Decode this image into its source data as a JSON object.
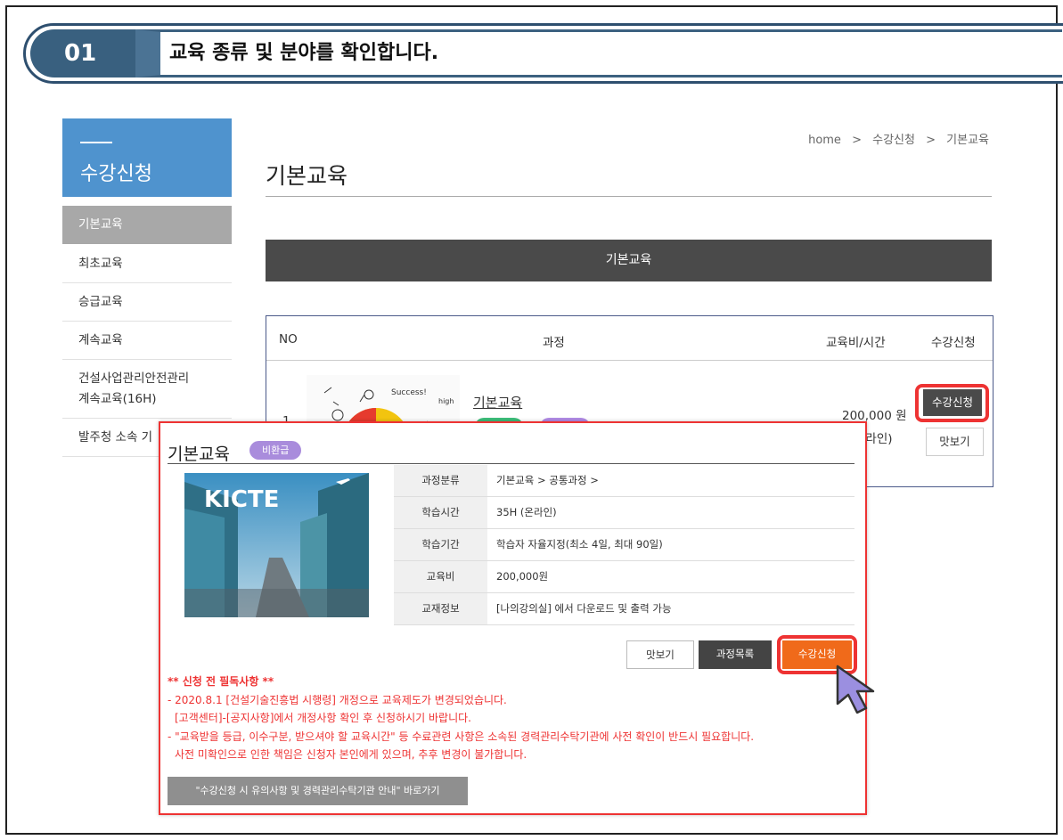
{
  "banner": {
    "step_number": "01",
    "title": "교육 종류 및 분야를 확인합니다."
  },
  "sidebar": {
    "heading": "수강신청",
    "items": [
      {
        "label": "기본교육",
        "active": true
      },
      {
        "label": "최초교육"
      },
      {
        "label": "승급교육"
      },
      {
        "label": "계속교육"
      },
      {
        "label": "건설사업관리안전관리"
      },
      {
        "label": "계속교육(16H)"
      },
      {
        "label": "발주청 소속 기"
      }
    ]
  },
  "breadcrumb": {
    "home": "home",
    "sep": ">",
    "level1": "수강신청",
    "level2": "기본교육"
  },
  "page": {
    "title": "기본교육",
    "section_bar": "기본교육"
  },
  "table": {
    "headers": {
      "no": "NO",
      "course": "과정",
      "fee_time": "교육비/시간",
      "apply": "수강신청"
    },
    "row": {
      "no": "1",
      "course_link": "기본교육",
      "price": "200,000 원",
      "mode": "온라인)",
      "apply_button": "수강신청",
      "preview_button": "맛보기"
    }
  },
  "popup": {
    "title": "기본교육",
    "badge": "비환급",
    "image_text": "KICTE",
    "info": [
      {
        "key": "과정분류",
        "value": "기본교육 > 공통과정 >"
      },
      {
        "key": "학습시간",
        "value": "35H (온라인)"
      },
      {
        "key": "학습기간",
        "value": "학습자 자율지정(최소 4일, 최대 90일)"
      },
      {
        "key": "교육비",
        "value": "200,000원"
      },
      {
        "key": "교재정보",
        "value": "[나의강의실] 에서 다운로드 및 출력 가능"
      }
    ],
    "buttons": {
      "preview": "맛보기",
      "list": "과정목록",
      "apply": "수강신청"
    },
    "notice": {
      "heading": "** 신청 전 필독사항 **",
      "line1": "- 2020.8.1 [건설기술진흥법 시행령] 개정으로 교육제도가 변경되었습니다.",
      "line2": "[고객센터]-[공지사항]에서 개정사항 확인 후 신청하시기 바랍니다.",
      "line3": "- \"교육받을 등급, 이수구분, 받으셔야 할 교육시간\" 등 수료관련 사항은 소속된 경력관리수탁기관에 사전 확인이 반드시 필요합니다.",
      "line4": "사전 미확인으로 인한 책임은 신청자 본인에게 있으며, 추후 변경이 불가합니다."
    },
    "notice_button": "\"수강신청 시 유의사항 및 경력관리수탁기관 안내\" 바로가기"
  },
  "colors": {
    "accent_blue": "#4f93ce",
    "banner_navy": "#39607f",
    "highlight_red": "#ee3333",
    "apply_orange": "#f06a1a",
    "badge_purple": "#a98cdc"
  }
}
